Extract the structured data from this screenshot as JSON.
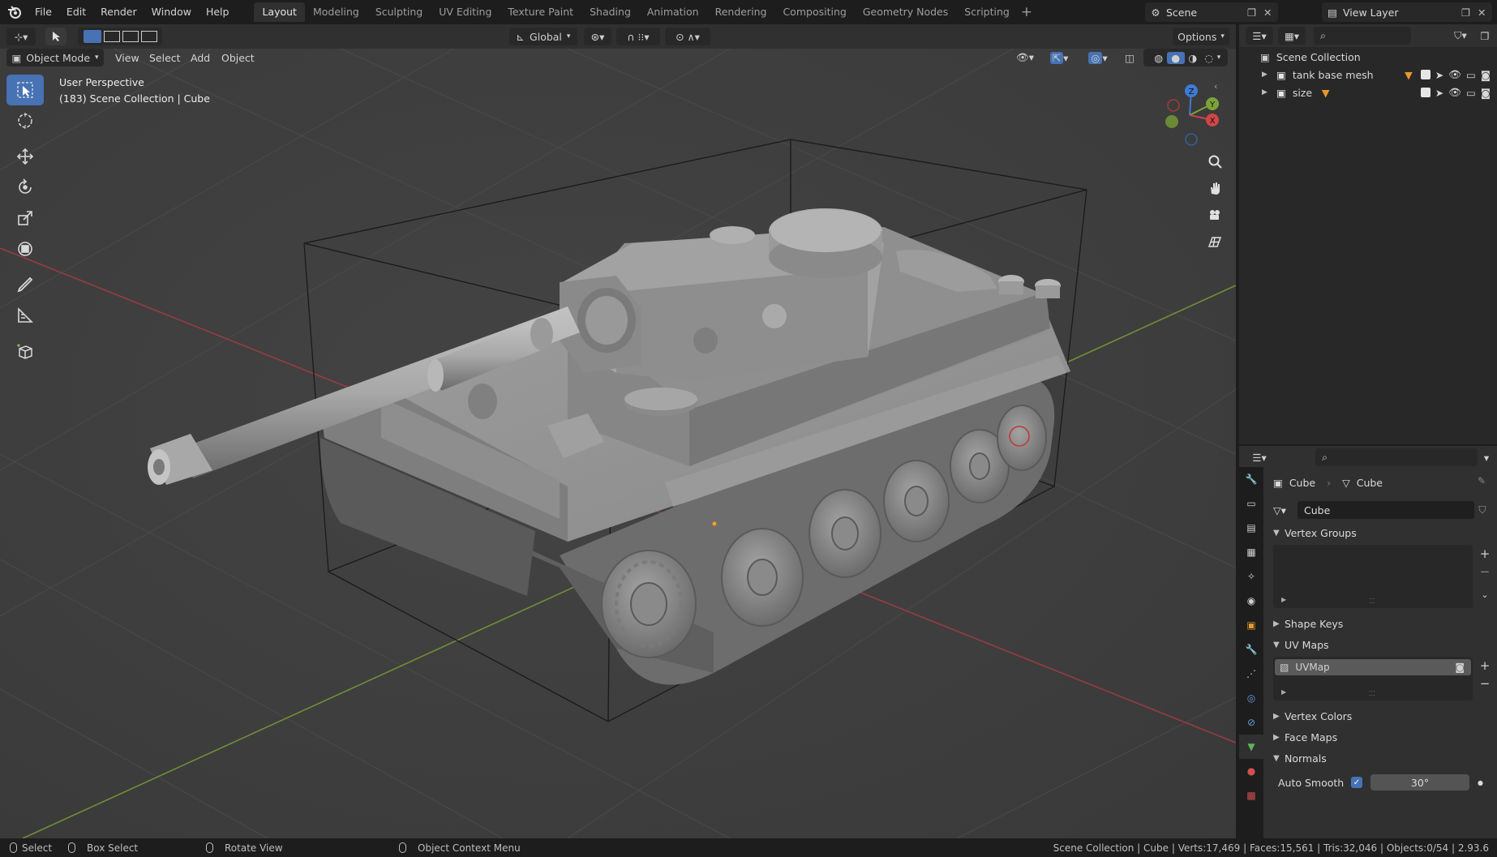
{
  "menu": {
    "items": [
      "File",
      "Edit",
      "Render",
      "Window",
      "Help"
    ]
  },
  "workspaces": {
    "active": "Layout",
    "tabs": [
      "Layout",
      "Modeling",
      "Sculpting",
      "UV Editing",
      "Texture Paint",
      "Shading",
      "Animation",
      "Rendering",
      "Compositing",
      "Geometry Nodes",
      "Scripting"
    ],
    "add_symbol": "+"
  },
  "scene": {
    "name": "Scene",
    "view_layer": "View Layer"
  },
  "viewport_header": {
    "transform_orientation": "Global",
    "options_label": "Options",
    "mode": "Object Mode",
    "menus": [
      "View",
      "Select",
      "Add",
      "Object"
    ]
  },
  "viewport": {
    "perspective": "User Perspective",
    "context": "(183) Scene Collection | Cube",
    "gizmo_axes": {
      "x": "X",
      "y": "Y",
      "z": "Z"
    },
    "colors": {
      "x_axis": "#b34242",
      "y_axis": "#7aa33a",
      "z_axis": "#3e7ad6",
      "active_tool": "#4772b3"
    }
  },
  "outliner": {
    "root": "Scene Collection",
    "items": [
      {
        "name": "tank base mesh"
      },
      {
        "name": "size"
      }
    ]
  },
  "properties": {
    "breadcrumb_object": "Cube",
    "breadcrumb_data": "Cube",
    "data_name": "Cube",
    "sections": {
      "vertex_groups": "Vertex Groups",
      "shape_keys": "Shape Keys",
      "uv_maps": "UV Maps",
      "vertex_colors": "Vertex Colors",
      "face_maps": "Face Maps",
      "normals": "Normals"
    },
    "uv_map_name": "UVMap",
    "auto_smooth_label": "Auto Smooth",
    "auto_smooth_angle": "30°",
    "auto_smooth_enabled": true
  },
  "statusbar": {
    "select": "Select",
    "box_select": "Box Select",
    "rotate_view": "Rotate View",
    "context_menu": "Object Context Menu",
    "stats": "Scene Collection | Cube | Verts:17,469 | Faces:15,561 | Tris:32,046 | Objects:0/54 | 2.93.6"
  }
}
